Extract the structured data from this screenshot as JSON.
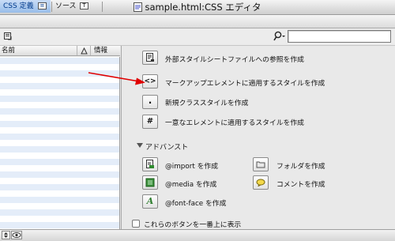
{
  "window": {
    "title": "sample.html:CSS エディタ"
  },
  "tabs": [
    {
      "label": "CSS 定義",
      "selected": true
    },
    {
      "label": "ソース",
      "selected": false
    }
  ],
  "search": {
    "placeholder": ""
  },
  "list": {
    "columns": [
      "名前",
      "情報"
    ]
  },
  "commands": [
    {
      "label": "外部スタイルシートファイルへの参照を作成",
      "icon": "stylesheet-link-icon"
    },
    {
      "label": "マークアップエレメントに適用するスタイルを作成",
      "icon": "markup-tag-icon",
      "symbol": "<>"
    },
    {
      "label": "新規クラススタイルを作成",
      "icon": "class-dot-icon",
      "symbol": "."
    },
    {
      "label": "一意なエレメントに適用するスタイルを作成",
      "icon": "id-hash-icon",
      "symbol": "#"
    }
  ],
  "advanced": {
    "heading": "アドバンスト",
    "items": [
      {
        "label": "@import を作成",
        "icon": "import-icon"
      },
      {
        "label": "@media を作成",
        "icon": "media-icon"
      },
      {
        "label": "@font-face を作成",
        "icon": "font-face-icon",
        "symbol": "A"
      },
      {
        "label": "フォルダを作成",
        "icon": "folder-icon"
      },
      {
        "label": "コメントを作成",
        "icon": "comment-icon"
      }
    ]
  },
  "footer": {
    "checkbox_label": "これらのボタンを一番上に表示",
    "checked": false
  },
  "colors": {
    "accent": "#98bde9",
    "arrow": "#e00000"
  }
}
